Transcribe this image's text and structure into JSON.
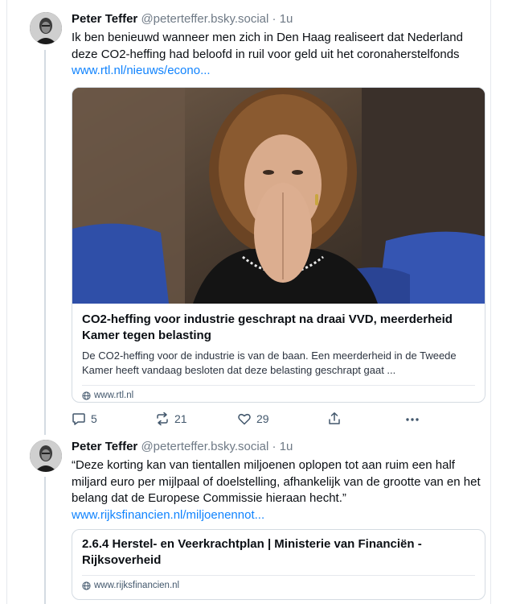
{
  "posts": [
    {
      "author_name": "Peter Teffer",
      "author_handle": "@peterteffer.bsky.social",
      "separator": "·",
      "time": "1u",
      "text": "Ik ben benieuwd wanneer men zich in Den Haag realiseert dat Nederland deze CO2-heffing had beloofd in ruil voor geld uit het coronaherstelfonds",
      "link_text": "www.rtl.nl/nieuws/econo...",
      "card": {
        "title": "CO2-heffing voor industrie geschrapt na draai VVD, meerderheid Kamer tegen belasting",
        "description": "De CO2-heffing voor de industrie is van de baan. Een meerderheid in de Tweede Kamer heeft vandaag besloten dat deze belasting geschrapt gaat ...",
        "domain": "www.rtl.nl"
      },
      "actions": {
        "replies": "5",
        "reposts": "21",
        "likes": "29"
      }
    },
    {
      "author_name": "Peter Teffer",
      "author_handle": "@peterteffer.bsky.social",
      "separator": "·",
      "time": "1u",
      "text": "“Deze korting kan van tientallen miljoenen oplopen tot aan ruim een half miljard euro per mijlpaal of doelstelling, afhankelijk van de grootte van en het belang dat de Europese Commissie hieraan hecht.”",
      "link_text": "www.rijksfinancien.nl/miljoenennot...",
      "card": {
        "title": "2.6.4 Herstel- en Veerkrachtplan | Ministerie van Financiën - Rijksoverheid",
        "domain": "www.rijksfinancien.nl"
      }
    }
  ],
  "icons": {
    "reply": "speech-bubble-icon",
    "repost": "repost-arrows-icon",
    "like": "heart-icon",
    "share": "share-upload-icon",
    "more": "ellipsis-icon",
    "globe": "globe-icon"
  },
  "colors": {
    "link": "#1083fe",
    "muted": "#6f7a86",
    "border": "#d4dbe2"
  }
}
